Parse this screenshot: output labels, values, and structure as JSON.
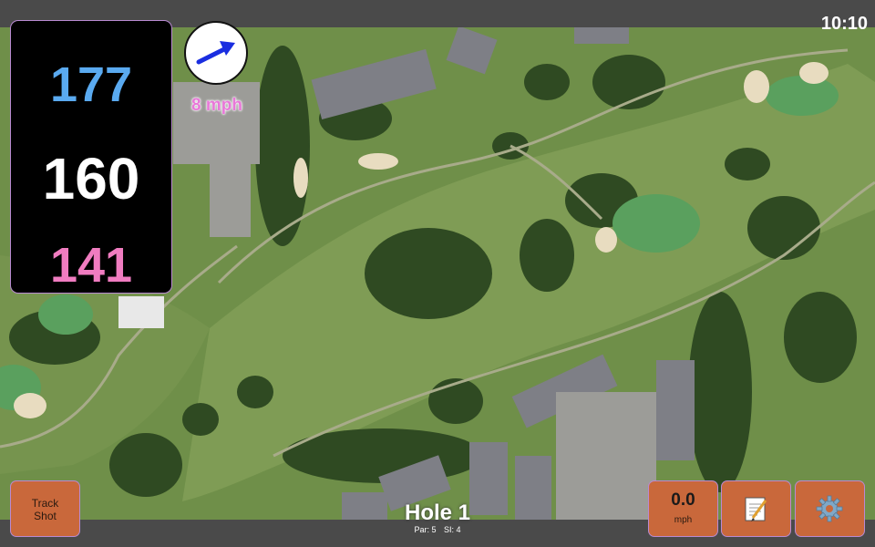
{
  "status": {
    "clock": "10:10"
  },
  "distances": {
    "back": "177",
    "center": "160",
    "front": "141"
  },
  "wind": {
    "speed": "8 mph",
    "icon": "wind-direction-arrow-icon"
  },
  "buttons": {
    "track_shot": {
      "line1": "Track",
      "line2": "Shot"
    },
    "speed": {
      "value": "0.0",
      "unit": "mph"
    },
    "notes": {
      "icon": "notepad-icon"
    },
    "settings": {
      "icon": "gear-icon"
    }
  },
  "hole": {
    "title": "Hole 1",
    "par": "Par: 5",
    "si": "SI: 4"
  },
  "colors": {
    "back": "#5aaaf0",
    "center": "#ffffff",
    "front": "#f07cc0",
    "button": "#c9683b",
    "wind_text": "#e878d8",
    "arrow": "#1a2ee0"
  }
}
